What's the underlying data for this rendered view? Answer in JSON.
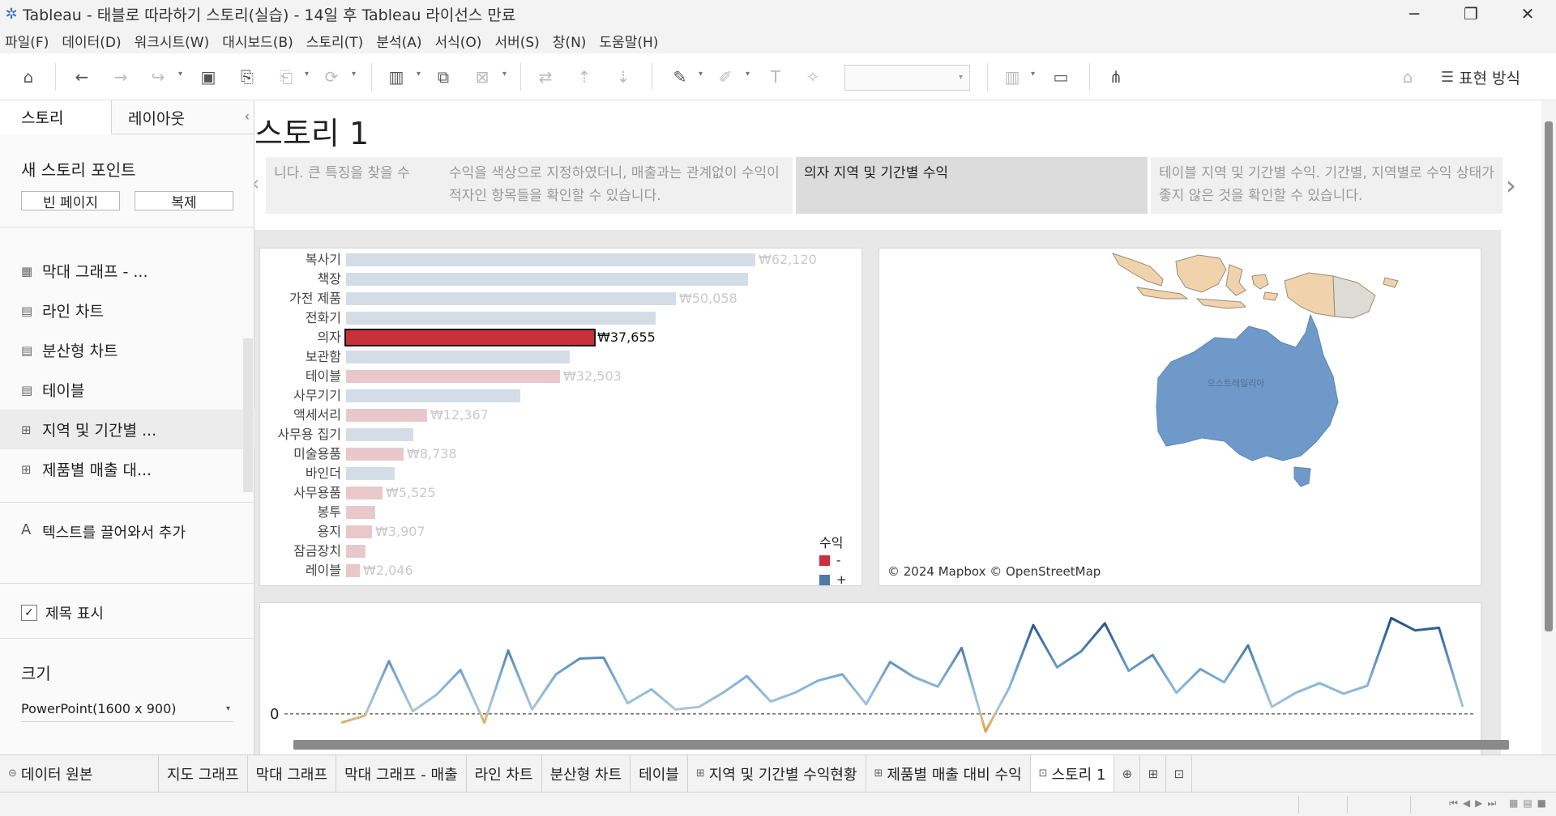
{
  "window": {
    "title": "Tableau - 태블로 따라하기 스토리(실습) - 14일 후 Tableau 라이선스 만료",
    "app_icon": "tableau-logo-icon",
    "controls": [
      "─",
      "❐",
      "✕"
    ]
  },
  "menu": [
    "파일(F)",
    "데이터(D)",
    "워크시트(W)",
    "대시보드(B)",
    "스토리(T)",
    "분석(A)",
    "서식(O)",
    "서버(S)",
    "창(N)",
    "도움말(H)"
  ],
  "toolbar": {
    "show_me_label": "표현 방식",
    "combo_value": ""
  },
  "left_pane": {
    "tabs": [
      "스토리",
      "레이아웃"
    ],
    "new_story_point": "새 스토리 포인트",
    "blank_button": "빈 페이지",
    "duplicate_button": "복제",
    "items": [
      {
        "label": "막대 그래프 - ...",
        "icon": "▦"
      },
      {
        "label": "라인 차트",
        "icon": "▤"
      },
      {
        "label": "분산형 차트",
        "icon": "▤"
      },
      {
        "label": "테이블",
        "icon": "▤"
      },
      {
        "label": "지역 및 기간별 ...",
        "icon": "⊞"
      },
      {
        "label": "제품별 매출 대...",
        "icon": "⊞"
      }
    ],
    "text_add": "텍스트를 끌어와서 추가",
    "text_add_icon": "A",
    "show_title": "제목 표시",
    "size_title": "크기",
    "size_value": "PowerPoint(1600 x 900)"
  },
  "story": {
    "title": "스토리 1",
    "captions": [
      "니다. 큰 특징을 찾을 수",
      "수익을 색상으로 지정하였더니, 매출과는 관계없이 수익이 적자인 항목들을 확인할 수 있습니다.",
      "의자 지역 및 기간별 수익",
      "테이블 지역 및 기간별 수익. 기간별, 지역별로 수익 상태가 좋지 않은 것을 확인할 수 있습니다."
    ]
  },
  "chart_data": [
    {
      "type": "bar",
      "categories": [
        "복사기",
        "책장",
        "가전 제품",
        "전화기",
        "의자",
        "보관함",
        "테이블",
        "사무기기",
        "액세서리",
        "사무용 집기",
        "미술용품",
        "바인더",
        "사무용품",
        "봉투",
        "용지",
        "잠금장치",
        "레이블"
      ],
      "values": [
        62120,
        61000,
        50058,
        47000,
        37655,
        34000,
        32503,
        26500,
        12367,
        10200,
        8738,
        7400,
        5525,
        4400,
        3907,
        3000,
        2046
      ],
      "labels": [
        "₩62,120",
        "",
        "₩50,058",
        "",
        "₩37,655",
        "",
        "₩32,503",
        "",
        "₩12,367",
        "",
        "₩8,738",
        "",
        "₩5,525",
        "",
        "₩3,907",
        "",
        "₩2,046"
      ],
      "profit_sign": [
        "+",
        "+",
        "+",
        "+",
        "-",
        "+",
        "-",
        "+",
        "-",
        "+",
        "-",
        "+",
        "-",
        "-",
        "-",
        "-",
        "-"
      ],
      "highlight": "의자",
      "legend_title": "수익",
      "legend": [
        {
          "name": "-",
          "color": "#c8303a"
        },
        {
          "name": "+",
          "color": "#4e79a7"
        }
      ],
      "xlim": [
        0,
        64000
      ]
    },
    {
      "type": "line",
      "y_zero_label": "0",
      "values": [
        -10,
        -2,
        60,
        3,
        22,
        50,
        -10,
        72,
        5,
        45,
        63,
        64,
        12,
        28,
        5,
        8,
        24,
        43,
        14,
        24,
        38,
        45,
        11,
        59,
        42,
        31,
        75,
        -20,
        30,
        101,
        53,
        71,
        103,
        49,
        67,
        24,
        51,
        36,
        78,
        8,
        24,
        35,
        23,
        32,
        109,
        95,
        98,
        8
      ],
      "ylim": [
        -25,
        115
      ]
    }
  ],
  "map": {
    "attribution": "© 2024 Mapbox © OpenStreetMap",
    "region_label": "오스트레일리아"
  },
  "sheet_tabs": [
    {
      "label": "데이터 원본",
      "icon": "⊝"
    },
    {
      "label": "지도 그래프",
      "icon": ""
    },
    {
      "label": "막대 그래프",
      "icon": ""
    },
    {
      "label": "막대 그래프 - 매출",
      "icon": ""
    },
    {
      "label": "라인 차트",
      "icon": ""
    },
    {
      "label": "분산형 차트",
      "icon": ""
    },
    {
      "label": "테이블",
      "icon": ""
    },
    {
      "label": "지역 및 기간별 수익현황",
      "icon": "⊞"
    },
    {
      "label": "제품별 매출 대비 수익",
      "icon": "⊞"
    },
    {
      "label": "스토리 1",
      "icon": "⊡"
    }
  ],
  "colors": {
    "negative": "#c8303a",
    "positive": "#4e79a7",
    "positive_light": "#d4dce6",
    "negative_light": "#e8c8cb",
    "land": "#f0d3ad"
  }
}
